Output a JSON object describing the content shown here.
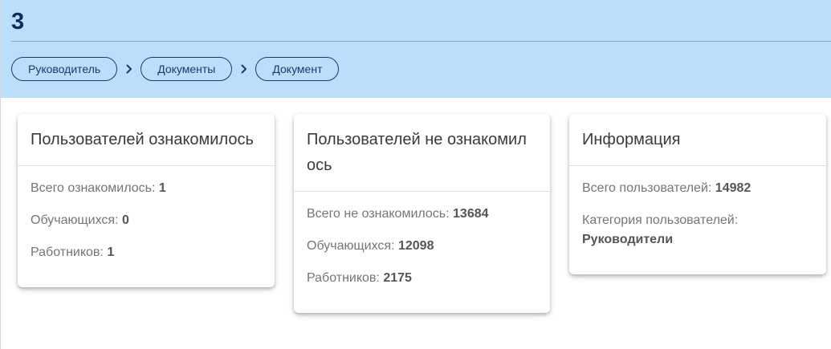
{
  "header": {
    "title": "3",
    "breadcrumb": [
      {
        "label": "Руководитель"
      },
      {
        "label": "Документы"
      },
      {
        "label": "Документ"
      }
    ]
  },
  "cards": {
    "acquainted": {
      "title": "Пользователей ознакомилось",
      "rows": [
        {
          "label": "Всего ознакомилось:",
          "value": "1"
        },
        {
          "label": "Обучающихся:",
          "value": "0"
        },
        {
          "label": "Работников:",
          "value": "1"
        }
      ]
    },
    "not_acquainted": {
      "title_line1": "Пользователей не ознакомил",
      "title_line2": "ось",
      "rows": [
        {
          "label": "Всего не ознакомилось:",
          "value": "13684"
        },
        {
          "label": "Обучающихся:",
          "value": "12098"
        },
        {
          "label": "Работников:",
          "value": "2175"
        }
      ]
    },
    "info": {
      "title": "Информация",
      "total_label": "Всего пользователей:",
      "total_value": "14982",
      "category_label": "Категория пользователей:",
      "category_value": "Руководители"
    }
  },
  "colors": {
    "header_bg": "#bbdefb",
    "title_color": "#0d2c5a",
    "crumb_border": "#1b3a66"
  },
  "icons": {
    "breadcrumb_separator": "chevron-right-icon"
  }
}
